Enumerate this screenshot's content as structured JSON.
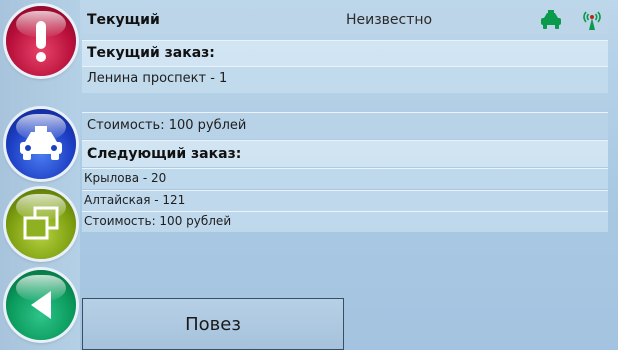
{
  "header": {
    "title": "Текущий",
    "status": "Неизвестно"
  },
  "current_order": {
    "label": "Текущий заказ:",
    "address": "Ленина проспект - 1",
    "cost": "Стоимость: 100 рублей"
  },
  "next_order": {
    "label": "Следующий заказ:",
    "address_from": "Крылова - 20",
    "address_to": "Алтайская - 121",
    "cost": "Стоимость: 100 рублей"
  },
  "actions": {
    "submit_label": "Повез"
  },
  "icons": {
    "alert": "alert-icon",
    "taxi": "taxi-icon",
    "windows": "windows-icon",
    "back": "back-arrow-icon",
    "status_taxi": "taxi-status-icon",
    "signal": "signal-icon"
  },
  "colors": {
    "background": "#a9c9e3",
    "alert_button": "#b8103a",
    "taxi_button": "#1d3fc4",
    "windows_button": "#7ea010",
    "back_button": "#0a9a5c",
    "status_icon": "#0a9a4c"
  }
}
